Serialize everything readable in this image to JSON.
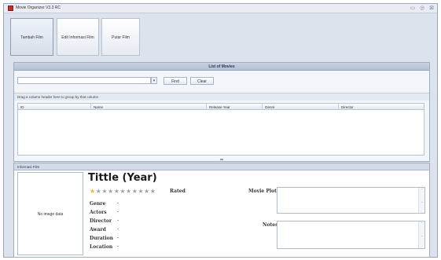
{
  "window": {
    "title": "Movie Organizer V3.3 RC"
  },
  "toolbar": {
    "add_label": "Tambah Film",
    "edit_label": "Edit Informasi Film",
    "play_label": "Putar Film"
  },
  "list": {
    "header": "List of Movies",
    "search_value": "",
    "find_label": "Find",
    "clear_label": "Clear",
    "group_hint": "Drag a column header here to group by that column",
    "columns": [
      "ID",
      "Name",
      "Release Year",
      "Genre",
      "Director"
    ]
  },
  "info": {
    "header": "Informasi Film",
    "photo_text": "No image data",
    "title": "Tittle (Year)",
    "rating": {
      "value": 0,
      "max": 10,
      "label": "Rated"
    },
    "fields": [
      {
        "label": "Genre",
        "value": "-"
      },
      {
        "label": "Actors",
        "value": "-"
      },
      {
        "label": "Director",
        "value": "-"
      },
      {
        "label": "Award",
        "value": "-"
      },
      {
        "label": "Duration",
        "value": "-"
      },
      {
        "label": "Location",
        "value": "-"
      }
    ],
    "plot_label": "Movie Plot",
    "notes_label": "Notes"
  },
  "colors": {
    "accent": "#c0312b",
    "star": "#e8b62c",
    "header": "#b3c1d6"
  }
}
